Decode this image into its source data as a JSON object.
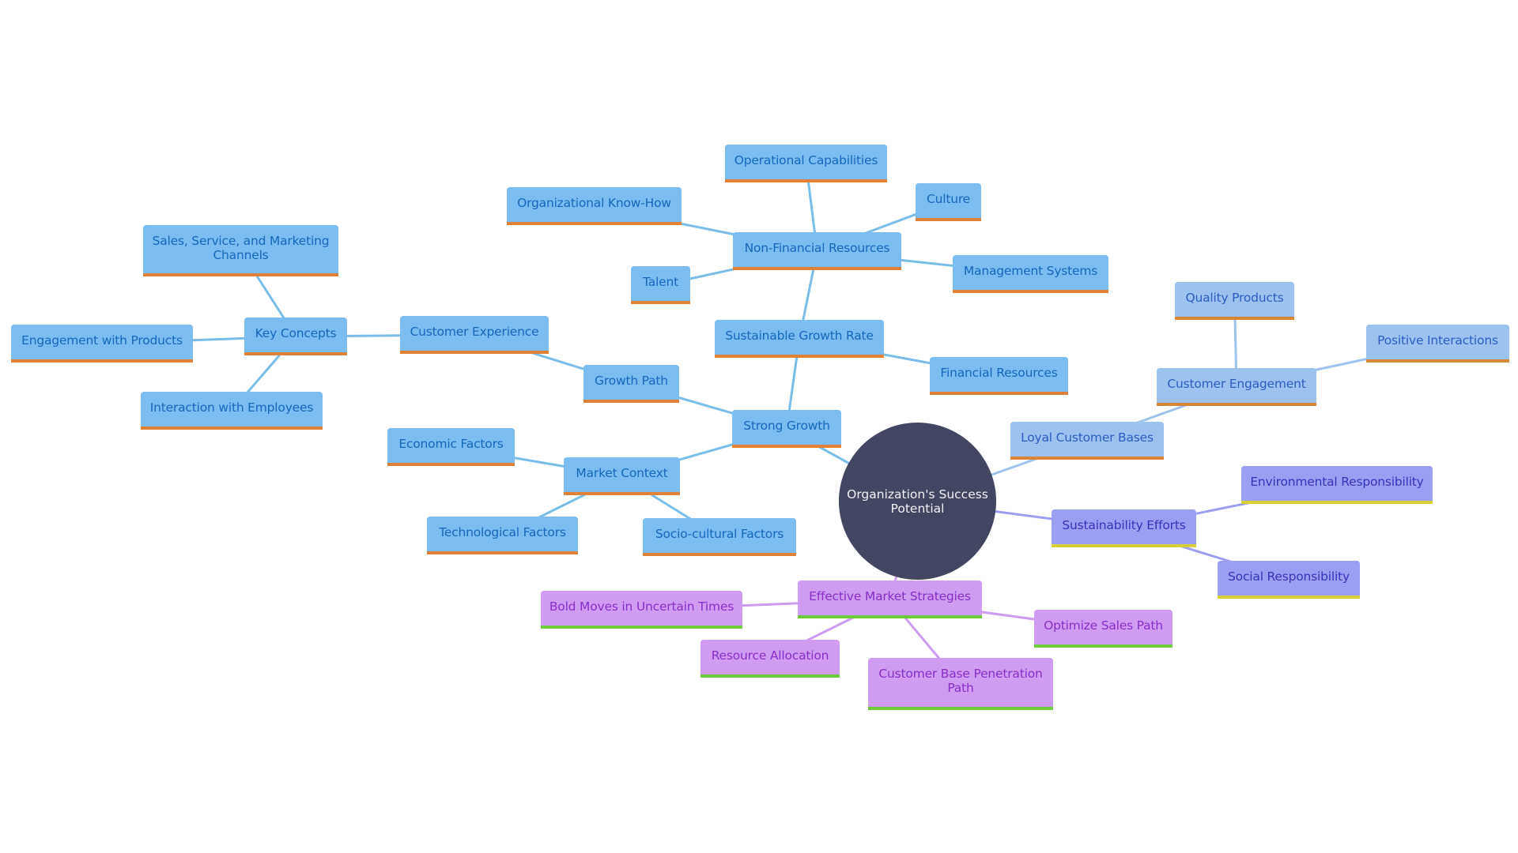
{
  "diagram": {
    "type": "mindmap",
    "root": {
      "id": "root",
      "label": "Organization's Success Potential"
    },
    "colors": {
      "root_fill": "#424660",
      "blue_branch_fill": "#7bbdf0",
      "blue_branch_text": "#1668bb",
      "blue_branch_accent": "#e08138",
      "light_blue_branch_fill": "#9cc3f0",
      "violet_branch_fill": "#9b9ff2",
      "violet_branch_accent": "#d6cf35",
      "purple_branch_fill": "#cf9cf2",
      "purple_branch_accent": "#6ecb3a"
    },
    "nodes": [
      {
        "id": "strong-growth",
        "label": "Strong Growth",
        "parent": "root",
        "style": "blue"
      },
      {
        "id": "sustainable-growth-rate",
        "label": "Sustainable Growth Rate",
        "parent": "strong-growth",
        "style": "blue"
      },
      {
        "id": "non-financial-resources",
        "label": "Non-Financial Resources",
        "parent": "sustainable-growth-rate",
        "style": "blue"
      },
      {
        "id": "operational-capabilities",
        "label": "Operational Capabilities",
        "parent": "non-financial-resources",
        "style": "blue"
      },
      {
        "id": "organizational-know-how",
        "label": "Organizational Know-How",
        "parent": "non-financial-resources",
        "style": "blue"
      },
      {
        "id": "culture",
        "label": "Culture",
        "parent": "non-financial-resources",
        "style": "blue"
      },
      {
        "id": "talent",
        "label": "Talent",
        "parent": "non-financial-resources",
        "style": "blue"
      },
      {
        "id": "management-systems",
        "label": "Management Systems",
        "parent": "non-financial-resources",
        "style": "blue"
      },
      {
        "id": "financial-resources",
        "label": "Financial Resources",
        "parent": "sustainable-growth-rate",
        "style": "blue"
      },
      {
        "id": "growth-path",
        "label": "Growth Path",
        "parent": "strong-growth",
        "style": "blue"
      },
      {
        "id": "customer-experience",
        "label": "Customer Experience",
        "parent": "growth-path",
        "style": "blue"
      },
      {
        "id": "key-concepts",
        "label": "Key Concepts",
        "parent": "customer-experience",
        "style": "blue"
      },
      {
        "id": "sales-service-marketing-channels",
        "label": "Sales, Service, and Marketing Channels",
        "parent": "key-concepts",
        "style": "blue"
      },
      {
        "id": "engagement-with-products",
        "label": "Engagement with Products",
        "parent": "key-concepts",
        "style": "blue"
      },
      {
        "id": "interaction-with-employees",
        "label": "Interaction with Employees",
        "parent": "key-concepts",
        "style": "blue"
      },
      {
        "id": "market-context",
        "label": "Market Context",
        "parent": "strong-growth",
        "style": "blue"
      },
      {
        "id": "economic-factors",
        "label": "Economic Factors",
        "parent": "market-context",
        "style": "blue"
      },
      {
        "id": "technological-factors",
        "label": "Technological Factors",
        "parent": "market-context",
        "style": "blue"
      },
      {
        "id": "socio-cultural-factors",
        "label": "Socio-cultural Factors",
        "parent": "market-context",
        "style": "blue"
      },
      {
        "id": "loyal-customer-bases",
        "label": "Loyal Customer Bases",
        "parent": "root",
        "style": "lblue"
      },
      {
        "id": "customer-engagement",
        "label": "Customer Engagement",
        "parent": "loyal-customer-bases",
        "style": "lblue"
      },
      {
        "id": "quality-products",
        "label": "Quality Products",
        "parent": "customer-engagement",
        "style": "lblue"
      },
      {
        "id": "positive-interactions",
        "label": "Positive Interactions",
        "parent": "customer-engagement",
        "style": "lblue"
      },
      {
        "id": "sustainability-efforts",
        "label": "Sustainability Efforts",
        "parent": "root",
        "style": "violet"
      },
      {
        "id": "environmental-responsibility",
        "label": "Environmental Responsibility",
        "parent": "sustainability-efforts",
        "style": "violet"
      },
      {
        "id": "social-responsibility",
        "label": "Social Responsibility",
        "parent": "sustainability-efforts",
        "style": "violet"
      },
      {
        "id": "effective-market-strategies",
        "label": "Effective Market Strategies",
        "parent": "root",
        "style": "purple"
      },
      {
        "id": "bold-moves",
        "label": "Bold Moves in Uncertain Times",
        "parent": "effective-market-strategies",
        "style": "purple"
      },
      {
        "id": "resource-allocation",
        "label": "Resource Allocation",
        "parent": "effective-market-strategies",
        "style": "purple"
      },
      {
        "id": "customer-base-penetration-path",
        "label": "Customer Base Penetration Path",
        "parent": "effective-market-strategies",
        "style": "purple"
      },
      {
        "id": "optimize-sales-path",
        "label": "Optimize Sales Path",
        "parent": "effective-market-strategies",
        "style": "purple"
      }
    ]
  }
}
